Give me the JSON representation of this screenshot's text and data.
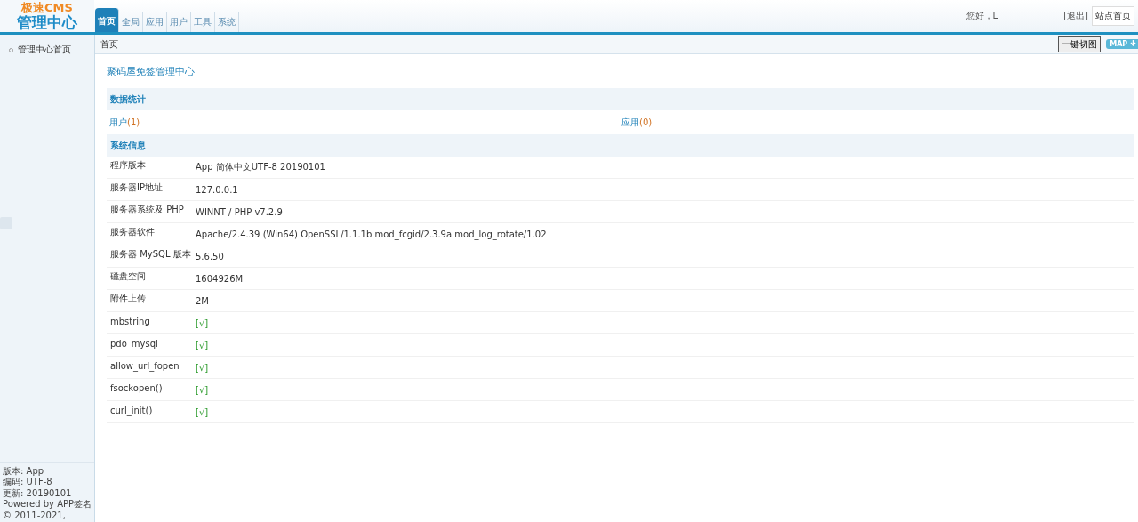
{
  "logo": {
    "line1": "极速CMS",
    "line2": "管理中心"
  },
  "tabs": [
    {
      "label": "首页",
      "selected": true
    },
    {
      "label": "全局",
      "selected": false
    },
    {
      "label": "应用",
      "selected": false
    },
    {
      "label": "用户",
      "selected": false
    },
    {
      "label": "工具",
      "selected": false
    },
    {
      "label": "系统",
      "selected": false
    }
  ],
  "user_bar": {
    "greeting": "您好，L",
    "logout": "[退出]",
    "site_home": "站点首页"
  },
  "breadcrumb": "首页",
  "toolbar": {
    "button": "一键切图",
    "map": "MAP"
  },
  "sidebar": {
    "items": [
      {
        "label": "管理中心首页",
        "selected": false
      }
    ],
    "footer": [
      "版本: App",
      "编码: UTF-8",
      "更新: 20190101",
      "Powered by APP签名",
      "© 2011-2021,"
    ]
  },
  "page_title": "聚码屋免签管理中心",
  "stats": {
    "title": "数据统计",
    "items": [
      {
        "label": "用户",
        "count": "(1)"
      },
      {
        "label": "应用",
        "count": "(0)"
      }
    ]
  },
  "system": {
    "title": "系统信息",
    "rows": [
      {
        "label": "程序版本",
        "value": "App 简体中文UTF-8 20190101",
        "kind": "text"
      },
      {
        "label": "服务器IP地址",
        "value": "127.0.0.1",
        "kind": "text"
      },
      {
        "label": "服务器系统及 PHP",
        "value": "WINNT / PHP v7.2.9",
        "kind": "text"
      },
      {
        "label": "服务器软件",
        "value": "Apache/2.4.39 (Win64) OpenSSL/1.1.1b mod_fcgid/2.3.9a mod_log_rotate/1.02",
        "kind": "text"
      },
      {
        "label": "服务器 MySQL 版本",
        "value": "5.6.50",
        "kind": "text"
      },
      {
        "label": "磁盘空间",
        "value": "1604926M",
        "kind": "text"
      },
      {
        "label": "附件上传",
        "value": "2M",
        "kind": "text"
      },
      {
        "label": "mbstring",
        "value": "[√]",
        "kind": "check"
      },
      {
        "label": "pdo_mysql",
        "value": "[√]",
        "kind": "check"
      },
      {
        "label": "allow_url_fopen",
        "value": "[√]",
        "kind": "check"
      },
      {
        "label": "fsockopen()",
        "value": "[√]",
        "kind": "check"
      },
      {
        "label": "curl_init()",
        "value": "[√]",
        "kind": "check"
      }
    ]
  }
}
